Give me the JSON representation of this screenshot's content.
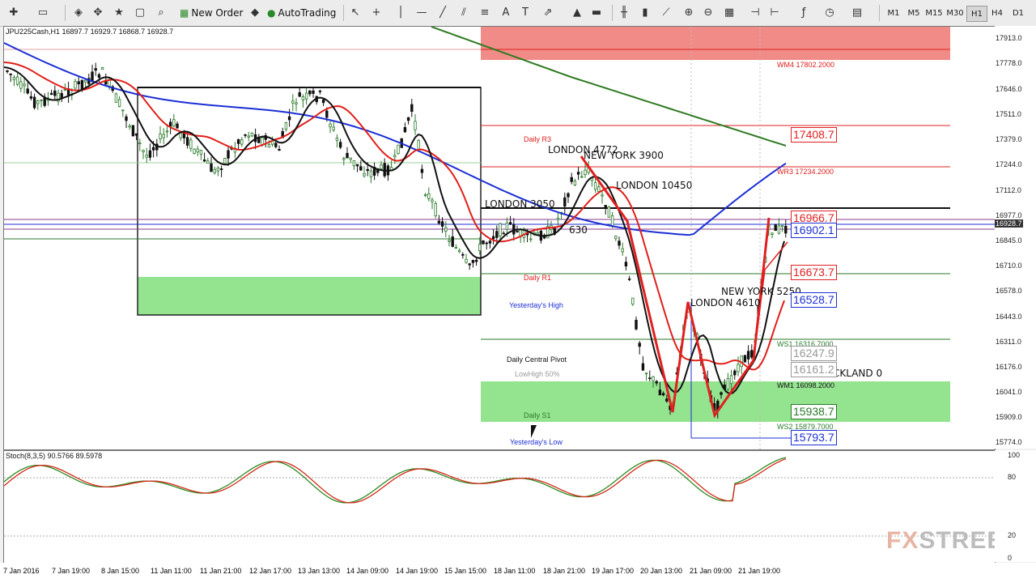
{
  "toolbar": {
    "new_order": "New Order",
    "autotrading": "AutoTrading",
    "timeframes": [
      "M1",
      "M5",
      "M15",
      "M30",
      "H1",
      "H4",
      "D1"
    ],
    "active_timeframe": "H1"
  },
  "chart": {
    "header": "JPU225Cash,H1  16897.7 16929.7 16868.7 16928.7",
    "colors": {
      "ma_blue": "#1c2fd4",
      "ma_green": "#2f7a22",
      "ma_red": "#e0201a",
      "ma_black": "#111111",
      "pivot_red": "#e02020",
      "pivot_green": "#2a7a2a",
      "zone_red": "#f08b87",
      "zone_green": "#94e38f"
    },
    "annotations": [
      {
        "text": "WM4 17802.2000",
        "color": "#e02020"
      },
      {
        "text": "Daily R3",
        "color": "#e02020"
      },
      {
        "text": "LONDON 4772",
        "color": "#111"
      },
      {
        "text": "NEW YORK  3900",
        "color": "#111"
      },
      {
        "text": "WR3 17234.2000",
        "color": "#e02020"
      },
      {
        "text": "LONDON 10450",
        "color": "#111"
      },
      {
        "text": "LONDON 3050",
        "color": "#111"
      },
      {
        "text": "630",
        "color": "#111"
      },
      {
        "text": "Daily R1",
        "color": "#e02020"
      },
      {
        "text": "Yesterday's High",
        "color": "#1c2fd4"
      },
      {
        "text": "LONDON 4610",
        "color": "#111"
      },
      {
        "text": "NEW YORK 5250",
        "color": "#111"
      },
      {
        "text": "WS1 16316.7000",
        "color": "#2a7a2a"
      },
      {
        "text": "Daily Central Pivot",
        "color": "#111"
      },
      {
        "text": "LowHigh 50%",
        "color": "#999"
      },
      {
        "text": "WM1 16098.2000",
        "color": "#111"
      },
      {
        "text": "CKLAND 0",
        "color": "#111"
      },
      {
        "text": "Daily S1",
        "color": "#2a7a2a"
      },
      {
        "text": "WS2 15879.7000",
        "color": "#2a7a2a"
      },
      {
        "text": "Yesterday's Low",
        "color": "#1c2fd4"
      }
    ],
    "price_boxes": [
      {
        "value": "17408.7",
        "color": "#e02020"
      },
      {
        "value": "16966.7",
        "color": "#e02020"
      },
      {
        "value": "16902.1",
        "color": "#1c2fd4"
      },
      {
        "value": "16673.7",
        "color": "#e02020"
      },
      {
        "value": "16528.7",
        "color": "#1c2fd4"
      },
      {
        "value": "16247.9",
        "color": "#999"
      },
      {
        "value": "16161.2",
        "color": "#999"
      },
      {
        "value": "15938.7",
        "color": "#2a7a2a"
      },
      {
        "value": "15793.7",
        "color": "#1c2fd4"
      }
    ],
    "price_axis": [
      "17913.0",
      "17778.0",
      "17646.0",
      "17511.0",
      "17379.0",
      "17244.0",
      "17112.0",
      "16977.0",
      "16928.7",
      "16845.0",
      "16710.0",
      "16578.0",
      "16443.0",
      "16311.0",
      "16176.0",
      "16041.0",
      "15909.0",
      "15774.0"
    ],
    "current_price": "16928.7"
  },
  "stoch": {
    "header": "Stoch(8,3,5) 90.5766 89.5978",
    "axis": [
      "100",
      "80",
      "20",
      "0"
    ]
  },
  "time_axis": [
    "7 Jan 2016",
    "7 Jan 19:00",
    "8 Jan 15:00",
    "11 Jan 11:00",
    "11 Jan 21:00",
    "12 Jan 17:00",
    "13 Jan 13:00",
    "14 Jan 09:00",
    "14 Jan 19:00",
    "15 Jan 15:00",
    "18 Jan 11:00",
    "18 Jan 21:00",
    "19 Jan 17:00",
    "20 Jan 13:00",
    "21 Jan 09:00",
    "21 Jan 19:00"
  ],
  "watermark": {
    "a": "FX",
    "b": "STREET"
  }
}
